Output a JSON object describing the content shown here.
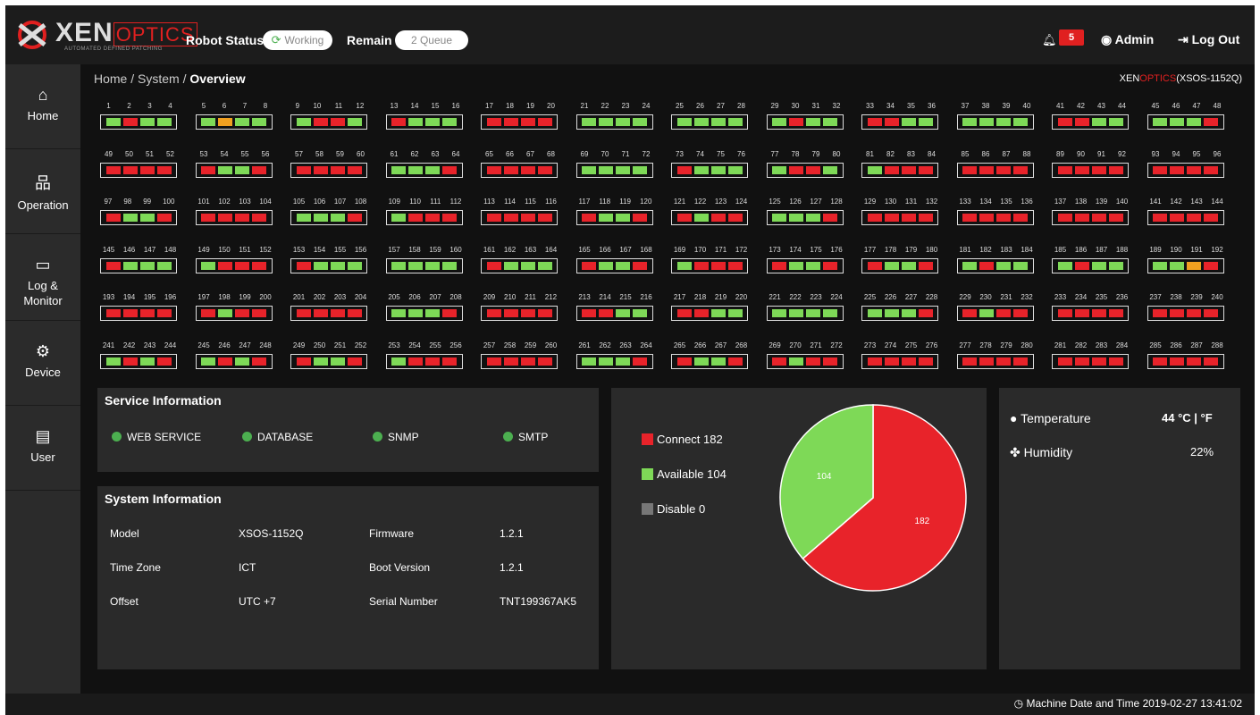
{
  "brand": {
    "part1": "XEN",
    "part2": "OPTICS",
    "tagline": "AUTOMATED DEFINED PATCHING"
  },
  "topbar": {
    "robot_status_label": "Robot Status",
    "robot_status_value": "Working",
    "remain_label": "Remain",
    "remain_value": "2 Queue",
    "notification_count": "5",
    "user_label": "Admin",
    "logout_label": "Log Out"
  },
  "sidebar": {
    "items": [
      {
        "label": "Home",
        "icon": "home-icon"
      },
      {
        "label": "Operation",
        "icon": "network-icon"
      },
      {
        "label": "Log & Monitor",
        "icon": "monitor-icon"
      },
      {
        "label": "Device",
        "icon": "gears-icon"
      },
      {
        "label": "User",
        "icon": "id-card-icon"
      }
    ]
  },
  "breadcrumb": {
    "home": "Home",
    "system": "System",
    "current": "Overview",
    "sep": " / "
  },
  "device_title": {
    "xen": "XEN",
    "optics": "OPTICS",
    "model": "(XSOS-1152Q)"
  },
  "colors": {
    "connect": "#e8232a",
    "available": "#7ed957",
    "disable": "#777777",
    "warning": "#f0a020"
  },
  "ports": {
    "rows": [
      [
        "GRGG",
        "GOGG",
        "GRRG",
        "RGGG",
        "RRRR",
        "GGGG",
        "GGGG",
        "GRGG",
        "RRGG",
        "GGGG",
        "RRGG",
        "GGGR"
      ],
      [
        "RRRR",
        "RGGR",
        "RRRR",
        "GGGR",
        "RRRR",
        "GGGG",
        "RGGG",
        "GRRG",
        "GRRR",
        "RRRR",
        "RRRR",
        "RRRR"
      ],
      [
        "RGGR",
        "RRRR",
        "GGGR",
        "GRRR",
        "RRRR",
        "RGGR",
        "RGRR",
        "GGGR",
        "RRRR",
        "RRRR",
        "RRRR",
        "RRRR"
      ],
      [
        "RGGG",
        "GRRR",
        "RGGG",
        "GGGG",
        "RGGG",
        "RGGR",
        "GRRR",
        "RGGR",
        "RGGR",
        "GRGG",
        "GRGG",
        "GGOR"
      ],
      [
        "RRRR",
        "RGRR",
        "RRRR",
        "GGGR",
        "RRRR",
        "RRGG",
        "RRGG",
        "GGGG",
        "GGGR",
        "RGRR",
        "RRRR",
        "RRRR"
      ],
      [
        "GRGR",
        "GRGR",
        "RGGR",
        "GRRR",
        "RRRR",
        "GGGR",
        "RGGR",
        "RGRR",
        "RRRR",
        "RRRR",
        "RRRR",
        "RRRR"
      ]
    ]
  },
  "service_info": {
    "title": "Service Information",
    "services": [
      "WEB SERVICE",
      "DATABASE",
      "SNMP",
      "SMTP"
    ]
  },
  "system_info": {
    "title": "System Information",
    "rows": [
      {
        "k1": "Model",
        "v1": "XSOS-1152Q",
        "k2": "Firmware",
        "v2": "1.2.1"
      },
      {
        "k1": "Time Zone",
        "v1": "ICT",
        "k2": "Boot Version",
        "v2": "1.2.1"
      },
      {
        "k1": "Offset",
        "v1": "UTC +7",
        "k2": "Serial Number",
        "v2": "TNT199367AK5"
      }
    ]
  },
  "chart_data": {
    "type": "pie",
    "labels": [
      "Connect",
      "Available",
      "Disable"
    ],
    "values": [
      182,
      104,
      0
    ],
    "legend": [
      "Connect 182",
      "Available 104",
      "Disable 0"
    ],
    "slice_labels": [
      "182",
      "104"
    ],
    "colors": [
      "#e8232a",
      "#7ed957",
      "#777777"
    ],
    "legend_position": "left"
  },
  "environment": {
    "temperature_label": "Temperature",
    "temperature_value": "44 °C | °F",
    "humidity_label": "Humidity",
    "humidity_value": "22%"
  },
  "footer": {
    "clock": "Machine Date and Time 2019-02-27 13:41:02"
  }
}
